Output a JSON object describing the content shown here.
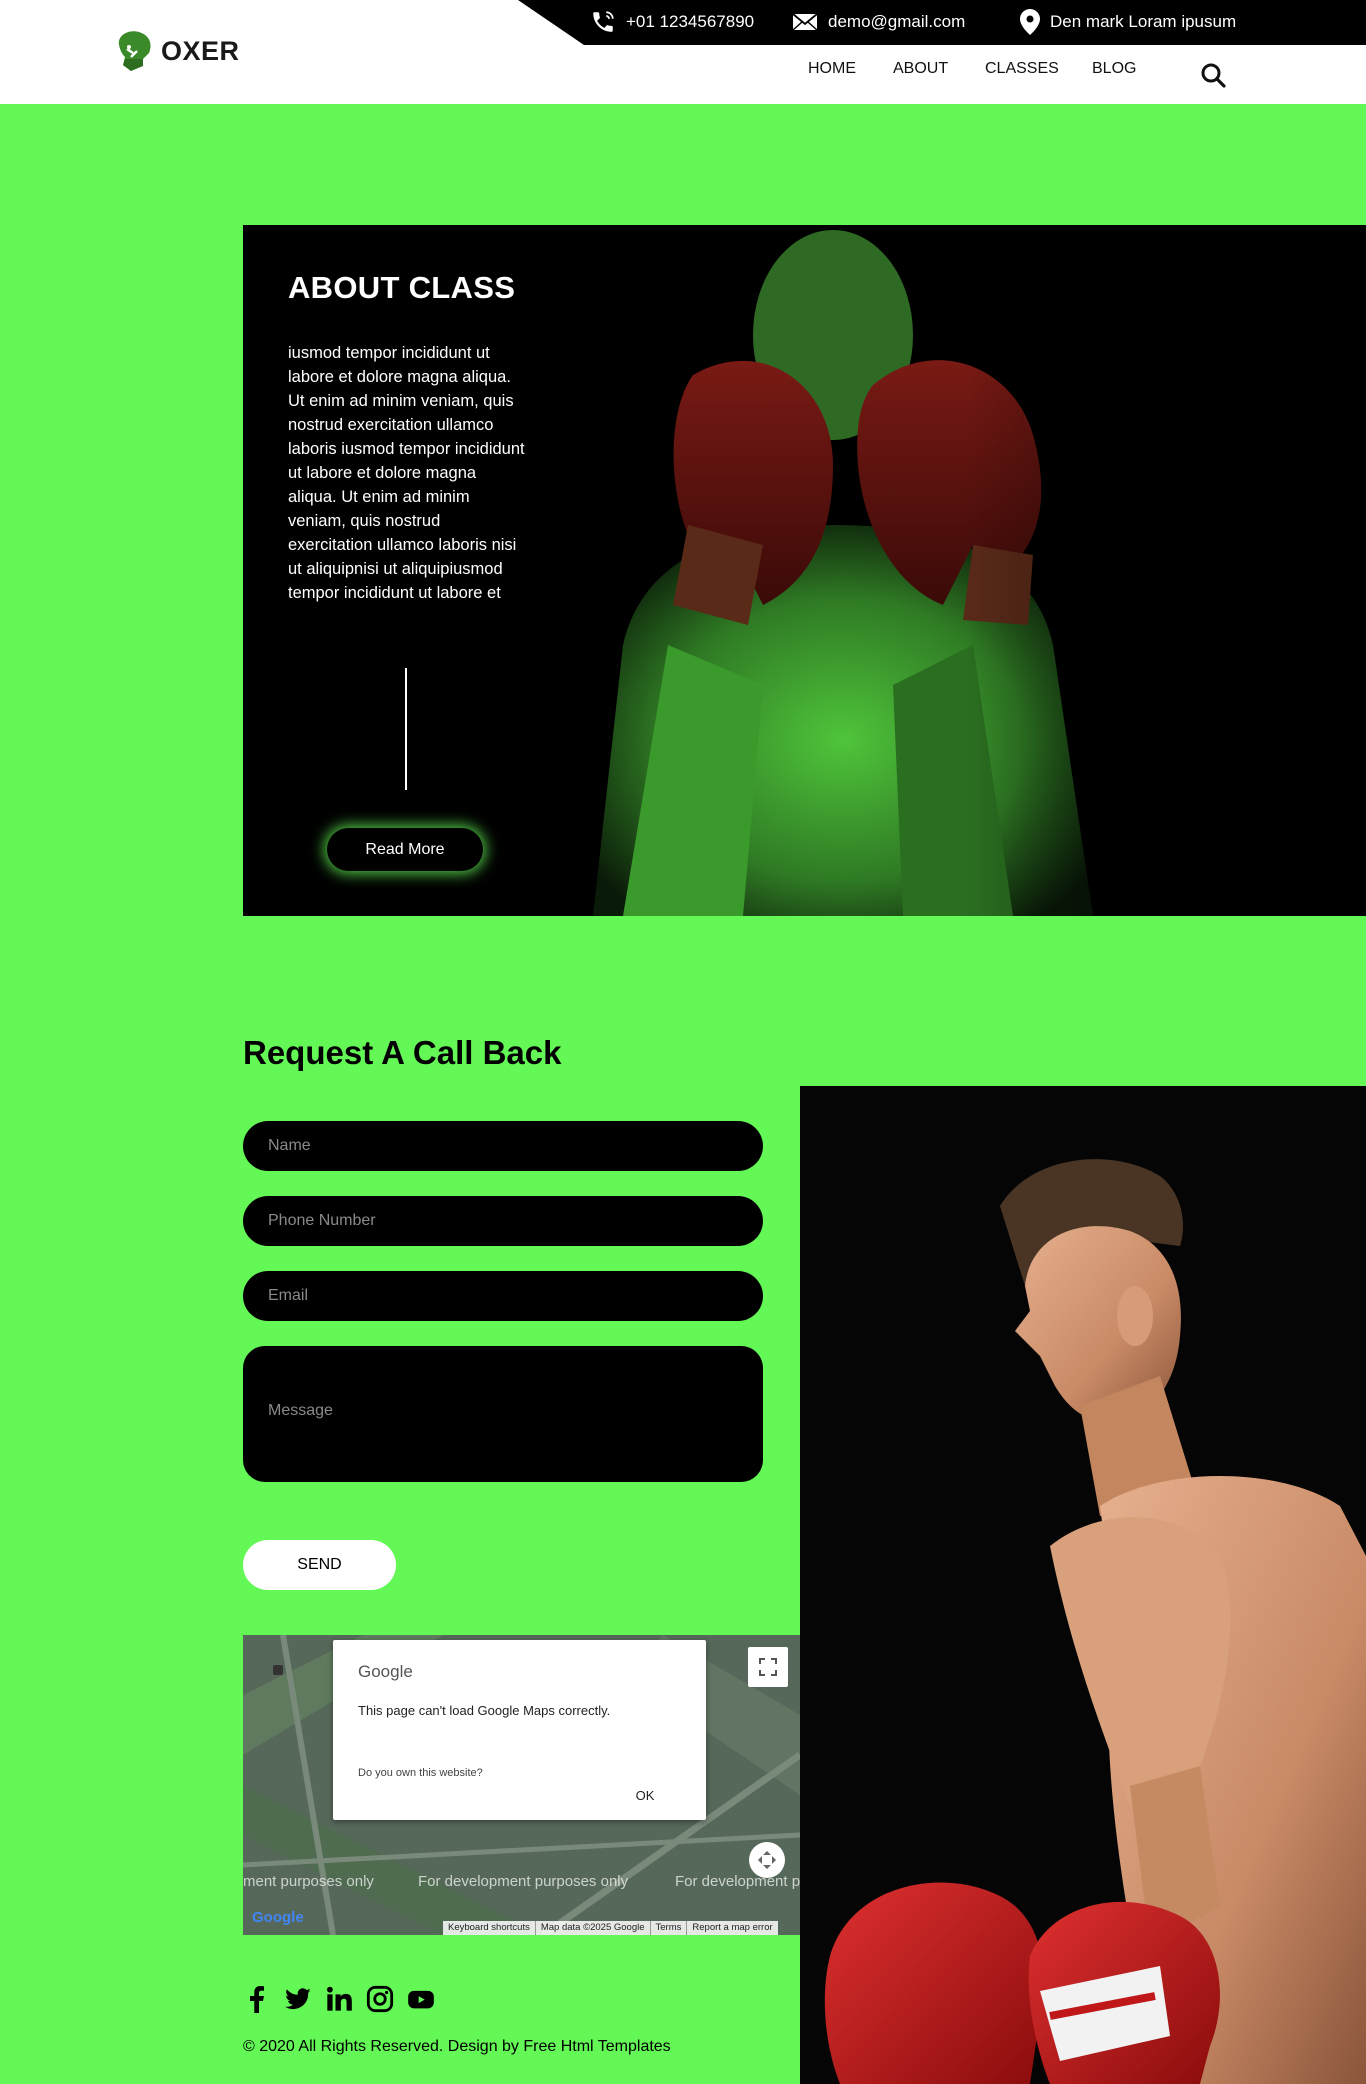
{
  "header": {
    "logo_text": "OXER",
    "contact": {
      "phone": "+01 1234567890",
      "email": "demo@gmail.com",
      "location": "Den mark Loram ipusum"
    },
    "nav": [
      {
        "label": "HOME"
      },
      {
        "label": "ABOUT"
      },
      {
        "label": "CLASSES"
      },
      {
        "label": "BLOG"
      }
    ]
  },
  "about": {
    "title": "ABOUT CLASS",
    "text": "iusmod tempor incididunt ut labore et dolore magna aliqua. Ut enim ad minim veniam, quis nostrud exercitation ullamco laboris iusmod tempor incididunt ut labore et dolore magna aliqua. Ut enim ad minim veniam, quis nostrud exercitation ullamco laboris nisi ut aliquipnisi ut aliquipiusmod tempor incididunt ut labore et",
    "read_more": "Read More"
  },
  "contact_form": {
    "title": "Request A Call Back",
    "name_placeholder": "Name",
    "phone_placeholder": "Phone Number",
    "email_placeholder": "Email",
    "message_placeholder": "Message",
    "send_label": "SEND"
  },
  "map": {
    "brand": "Google",
    "error_message": "This page can't load Google Maps correctly.",
    "own_question": "Do you own this website?",
    "ok_label": "OK",
    "dev_text_1": "ment purposes only",
    "dev_text_2": "For development purposes only",
    "dev_text_3": "For development p",
    "footer_links": [
      "Keyboard shortcuts",
      "Map data ©2025 Google",
      "Terms",
      "Report a map error"
    ],
    "logo_text": "Google"
  },
  "footer": {
    "social": [
      "facebook-icon",
      "twitter-icon",
      "linkedin-icon",
      "instagram-icon",
      "youtube-icon"
    ],
    "copyright": "© 2020 All Rights Reserved. Design by Free Html Templates"
  },
  "colors": {
    "accent": "#63f855",
    "dark": "#000000"
  }
}
